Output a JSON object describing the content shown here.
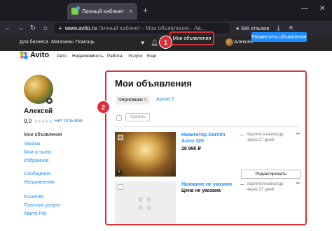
{
  "browser": {
    "tab_title": "Личный кабинет - Мои",
    "tab_close": "✕",
    "new_tab": "+",
    "win_min": "—",
    "win_close": "✕",
    "url_domain": "www.avito.ru",
    "url_rest": "Личный кабинет - Мои объявления - Ав...",
    "rating_text": "★ 68К отзывов",
    "back_icon": "arrow-left-icon",
    "forward_icon": "arrow-right-icon",
    "reload_icon": "reload-icon",
    "home_icon": "home-icon"
  },
  "topmenu": {
    "for_business": "Для бизнеса",
    "shops": "Магазины",
    "help": "Помощь",
    "my_ads": "Мои объявления",
    "user_name": "Алексей",
    "post_ad": "Разместить объявление"
  },
  "site": {
    "logo": "Avito",
    "categories": [
      "Авто",
      "Недвижимость",
      "Работа",
      "Услуги",
      "Ещё"
    ]
  },
  "sidebar": {
    "name": "Алексей",
    "rating": "0,0",
    "no_reviews": "Нет отзывов",
    "items": [
      {
        "label": "Мои объявления"
      },
      {
        "label": "Заказы"
      },
      {
        "label": "Мои отзывы"
      },
      {
        "label": "Избранное"
      },
      {
        "label": "Сообщения"
      },
      {
        "label": "Уведомления"
      },
      {
        "label": "Кошелёк"
      },
      {
        "label": "Платные услуги"
      },
      {
        "label": "Авито Pro"
      }
    ]
  },
  "main": {
    "title": "Мои объявления",
    "tab_drafts": "Черновики",
    "tab_drafts_count": "5",
    "tab_archive": "Архив 2",
    "delete_label": "Удалить",
    "ads": [
      {
        "title_line1": "Навигатор Garmin",
        "title_line2": "Astro 320",
        "price": "28 990 ₽",
        "status_line1": "Удалится навсегда",
        "status_line2": "через 27 дней",
        "photo_count": "5",
        "edit_label": "Редактировать"
      },
      {
        "title_line1": "Название не указано",
        "title_line2": "",
        "price": "Цена не указана",
        "status_line1": "Удалится навсегда",
        "status_line2": "через 27 дней"
      }
    ]
  },
  "callouts": {
    "one": "1",
    "two": "2"
  },
  "colors": {
    "accent": "#1c8cff",
    "highlight": "#d9303a",
    "dark_bar": "#262626"
  }
}
